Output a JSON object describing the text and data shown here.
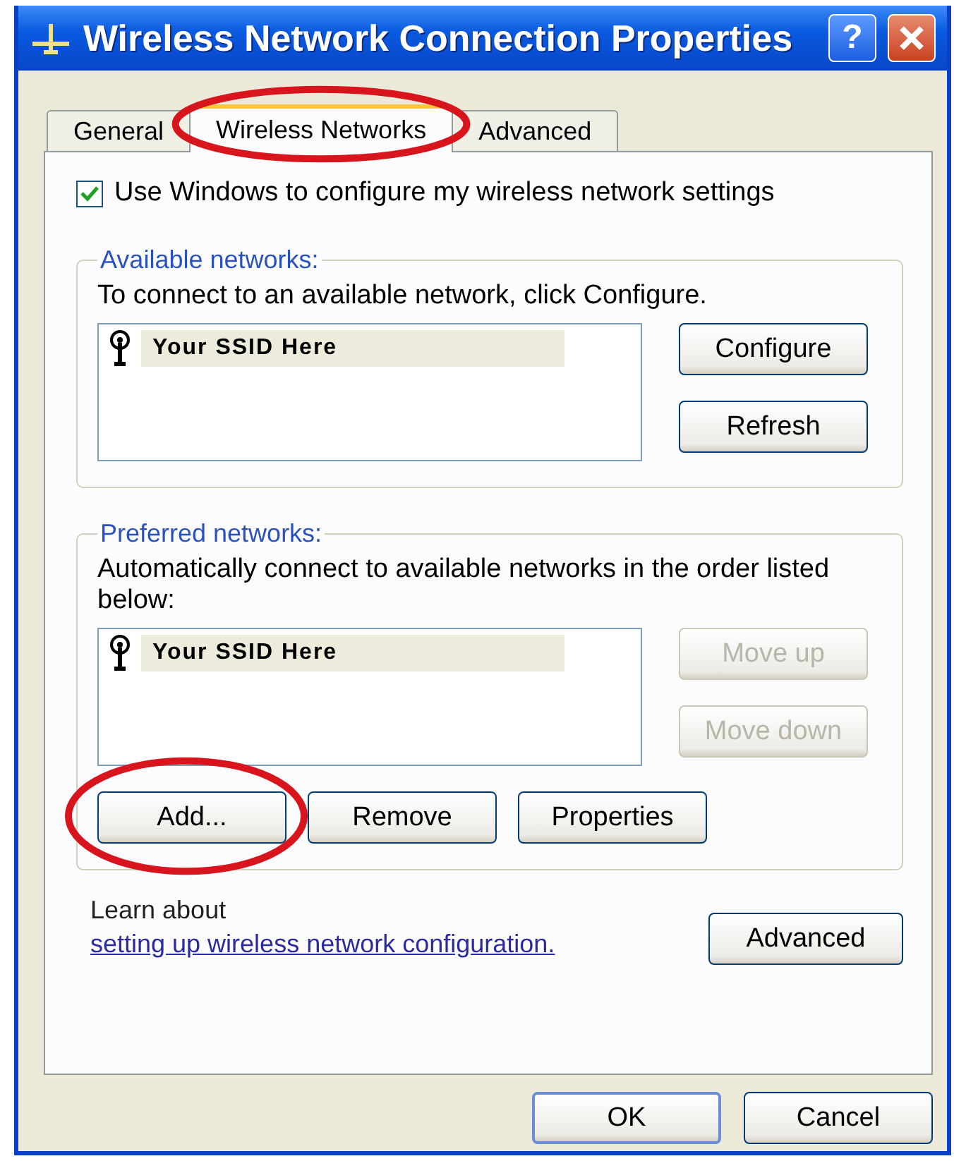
{
  "window": {
    "title": "Wireless Network Connection Properties",
    "help_button": "?"
  },
  "tabs": [
    {
      "label": "General",
      "selected": false,
      "highlighted": false
    },
    {
      "label": "Wireless Networks",
      "selected": true,
      "highlighted": true
    },
    {
      "label": "Advanced",
      "selected": false,
      "highlighted": false
    }
  ],
  "use_windows_checkbox": {
    "label": "Use Windows to configure my wireless network settings",
    "checked": true
  },
  "available_networks": {
    "title": "Available networks:",
    "instruction": "To connect to an available network, click Configure.",
    "networks": [
      {
        "ssid": "Your SSID Here"
      }
    ],
    "buttons": [
      {
        "label": "Configure",
        "disabled": false
      },
      {
        "label": "Refresh",
        "disabled": false
      }
    ]
  },
  "preferred_networks": {
    "title": "Preferred networks:",
    "instruction": "Automatically connect to available networks in the order listed below:",
    "networks": [
      {
        "ssid": "Your SSID Here"
      }
    ],
    "side_buttons": [
      {
        "label": "Move up",
        "disabled": true
      },
      {
        "label": "Move down",
        "disabled": true
      }
    ],
    "bottom_buttons": [
      {
        "label": "Add...",
        "disabled": false,
        "highlighted": true
      },
      {
        "label": "Remove",
        "disabled": false,
        "highlighted": false
      },
      {
        "label": "Properties",
        "disabled": false,
        "highlighted": false
      }
    ]
  },
  "learn_more": {
    "text": "Learn about",
    "link": "setting up wireless network configuration."
  },
  "advanced_button": {
    "label": "Advanced"
  },
  "dialog_buttons": [
    {
      "label": "OK",
      "default": true
    },
    {
      "label": "Cancel",
      "default": false
    }
  ]
}
